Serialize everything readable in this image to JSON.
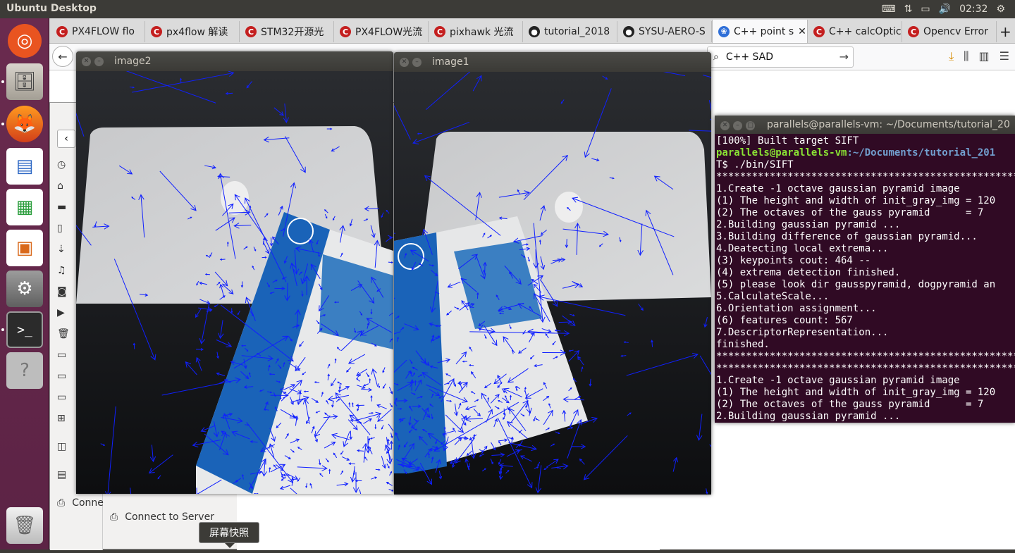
{
  "topbar": {
    "title": "Ubuntu Desktop",
    "time": "02:32",
    "icons": [
      "keyboard-icon",
      "network-icon",
      "battery-icon",
      "volume-icon",
      "settings-gear-icon"
    ]
  },
  "launcher": {
    "items": [
      "ubuntu-logo-icon",
      "files-icon",
      "firefox-icon",
      "writer-icon",
      "calc-icon",
      "impress-icon",
      "settings-icon",
      "terminal-icon",
      "help-icon",
      "trash-icon"
    ]
  },
  "browser": {
    "tabs": [
      {
        "label": "PX4FLOW flo",
        "icon": "C"
      },
      {
        "label": "px4flow 解读",
        "icon": "C"
      },
      {
        "label": "STM32开源光",
        "icon": "C"
      },
      {
        "label": "PX4FLOW光流",
        "icon": "C"
      },
      {
        "label": "pixhawk 光流",
        "icon": "C"
      },
      {
        "label": "tutorial_2018",
        "icon": "gh"
      },
      {
        "label": "SYSU-AERO-S",
        "icon": "gh"
      },
      {
        "label": "C++ point s",
        "icon": "bd",
        "active": true
      },
      {
        "label": "C++ calcOptic",
        "icon": "C"
      },
      {
        "label": "Opencv Error",
        "icon": "C"
      }
    ],
    "new_tab": "+",
    "search_value": "C++ SAD"
  },
  "filemanager": {
    "connect_label_partial": "Conne",
    "connect_label": "Connect to Server"
  },
  "windows": {
    "image2_title": "image2",
    "image1_title": "image1"
  },
  "terminal": {
    "title": "parallels@parallels-vm: ~/Documents/tutorial_20",
    "line1": "[100%] Built target SIFT",
    "prompt_user": "parallels@parallels-vm",
    "prompt_path": ":~/Documents/tutorial_201",
    "prompt_cont": "T$ ./bin/SIFT",
    "lines": [
      "*******************************************************",
      "1.Create -1 octave gaussian pyramid image",
      "(1) The height and width of init_gray_img = 120",
      "(2) The octaves of the gauss pyramid      = 7",
      "2.Building gaussian pyramid ...",
      "3.Building difference of gaussian pyramid...",
      "4.Deatecting local extrema...",
      "(3) keypoints cout: 464 --",
      "(4) extrema detection finished.",
      "(5) please look dir gausspyramid, dogpyramid an",
      "5.CalculateScale...",
      "6.Orientation assignment...",
      "(6) features count: 567",
      "7.DescriptorRepresentation...",
      "finished.",
      "*******************************************************",
      "*******************************************************",
      "1.Create -1 octave gaussian pyramid image",
      "(1) The height and width of init_gray_img = 120",
      "(2) The octaves of the gauss pyramid      = 7",
      "2.Building gaussian pyramid ..."
    ]
  },
  "tooltip": "屏幕快照",
  "colors": {
    "launcher": "#5c2345",
    "terminal_bg": "#300a24",
    "prompt_green": "#8ae234",
    "prompt_blue": "#729fcf",
    "keypoint_arrows": "#1020ff"
  }
}
